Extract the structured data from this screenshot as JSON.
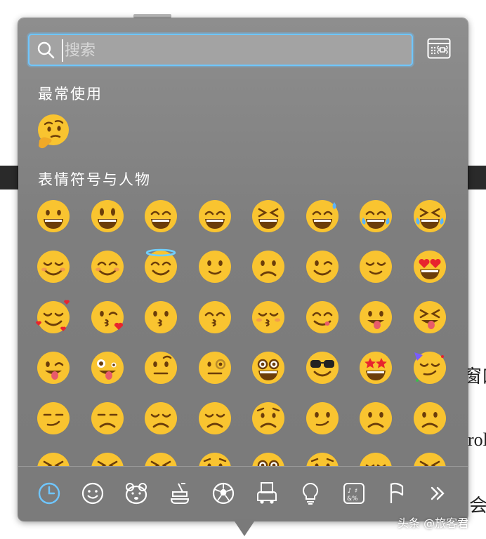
{
  "search": {
    "placeholder": "搜索",
    "value": ""
  },
  "sections": {
    "frequently_used": "最常使用",
    "smileys_people": "表情符号与人物"
  },
  "colors": {
    "accent": "#6fc6ff",
    "panel": "#7e7e7e",
    "emoji_face": "#f9c430"
  },
  "background_page": {
    "text_1": "窗口",
    "text_2": "rol",
    "text_3": "会"
  },
  "watermark": "头条 @旅客君",
  "frequently_used_emojis": [
    "thinking-face"
  ],
  "smiley_rows": [
    [
      "grinning-face",
      "grinning-face-big-eyes",
      "grinning-smiling-eyes",
      "beaming-face",
      "squinting-laughing",
      "grinning-sweat",
      "tears-of-joy",
      "rolling-laughing"
    ],
    [
      "smiling-face",
      "smiling-blushing",
      "halo-face",
      "slightly-smiling",
      "upside-down-face",
      "winking-face",
      "relieved-face",
      "heart-eyes"
    ],
    [
      "smiling-hearts",
      "kissing-heart",
      "kissing-face",
      "kissing-smiling-eyes",
      "kissing-closed-eyes",
      "savoring-food",
      "tongue-face",
      "squinting-tongue"
    ],
    [
      "winking-tongue",
      "zany-face",
      "raised-eyebrow",
      "monocle-face",
      "nerd-face",
      "sunglasses-face",
      "star-struck",
      "partying-face"
    ],
    [
      "smirking-face",
      "unamused-face",
      "disappointed-face",
      "pensive-face",
      "worried-face",
      "confused-face",
      "slightly-frowning",
      "frowning-face"
    ],
    [
      "persevering-face",
      "confounded-face",
      "tired-face",
      "weary-face",
      "pleading-face",
      "crying-face",
      "loudly-crying",
      "steam-nose"
    ]
  ],
  "categories": [
    {
      "icon": "clock-icon",
      "active": true
    },
    {
      "icon": "smiley-icon"
    },
    {
      "icon": "animal-icon"
    },
    {
      "icon": "food-icon"
    },
    {
      "icon": "soccer-ball-icon"
    },
    {
      "icon": "travel-icon"
    },
    {
      "icon": "lightbulb-icon"
    },
    {
      "icon": "symbols-icon"
    },
    {
      "icon": "flag-icon"
    },
    {
      "icon": "more-icon"
    }
  ]
}
